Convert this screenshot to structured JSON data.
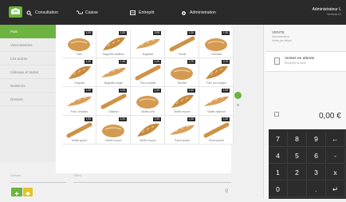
{
  "topbar": {
    "menus": [
      {
        "icon": "search-icon",
        "label": "Consultation"
      },
      {
        "icon": "cart-icon",
        "label": "Caisse"
      },
      {
        "icon": "store-icon",
        "label": "Entrepôt"
      },
      {
        "icon": "gear-icon",
        "label": "Administration"
      }
    ],
    "user": {
      "name": "Administrateur L",
      "terminal": "Terminal 01"
    }
  },
  "sidebar": {
    "categories": [
      {
        "label": "Pain",
        "active": true
      },
      {
        "label": "Viennoiseries"
      },
      {
        "label": "Les autres"
      },
      {
        "label": "Gâteaux et tartes"
      },
      {
        "label": "Boissons"
      },
      {
        "label": "Dessert"
      }
    ]
  },
  "products": [
    {
      "name": "Pain",
      "price": "1,00"
    },
    {
      "name": "Baguette tradition",
      "price": "1,00"
    },
    {
      "name": "Baguette",
      "price": "0,95"
    },
    {
      "name": "Ficelle",
      "price": "1,00"
    },
    {
      "name": "Céréales",
      "price": "1,00"
    },
    {
      "name": "Chapata",
      "price": "1,00"
    },
    {
      "name": "Baguette seigle",
      "price": "1,40"
    },
    {
      "name": "Pain complet",
      "price": "1,00"
    },
    {
      "name": "Bûcheil",
      "price": "0,70"
    },
    {
      "name": "Pain aux seigles",
      "price": "0,70"
    },
    {
      "name": "Pain Céréales",
      "price": "1,00"
    },
    {
      "name": "Gâteaux",
      "price": "1,00"
    },
    {
      "name": "Muffin petit",
      "price": "1,00"
    },
    {
      "name": "Muffin moyen",
      "price": "2,40"
    },
    {
      "name": "Muffin vitaminé",
      "price": "1,00"
    },
    {
      "name": "Muffin grand",
      "price": "1,00"
    },
    {
      "name": "Muffin moyen",
      "price": "1,00"
    },
    {
      "name": "Muffin moyen",
      "price": "1,00"
    },
    {
      "name": "Pains quatre",
      "price": "1,00"
    },
    {
      "name": "Pains quatre",
      "price": "1,00"
    }
  ],
  "pager": {
    "current": "2"
  },
  "bottom": {
    "options_label": "Options",
    "client_label": "Client"
  },
  "sale": {
    "title": "VENTE",
    "operator": "Administrateur",
    "subtitle": "Vente par défaut",
    "waiting_title": "Ventes en attente",
    "waiting_sub": "Récupérer la vente",
    "total": "0,00 €"
  },
  "keypad": [
    "7",
    "8",
    "9",
    "←",
    "4",
    "5",
    "6",
    "-",
    "1",
    "2",
    "3",
    "x",
    "0",
    "",
    ".",
    "↵"
  ],
  "colors": {
    "accent": "#6db33f",
    "topbar": "#2a2a2a",
    "keypad": "#2c2c2c",
    "yellow_button": "#e6c228"
  }
}
